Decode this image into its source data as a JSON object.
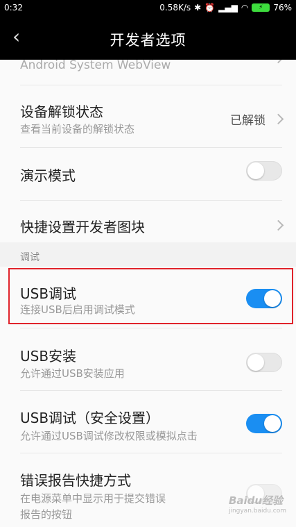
{
  "status": {
    "time": "0:32",
    "net_speed": "0.58K/s",
    "battery": "76%"
  },
  "header": {
    "title": "开发者选项"
  },
  "items": {
    "webview": {
      "title": "Android System WebView"
    },
    "unlock": {
      "title": "设备解锁状态",
      "subtitle": "查看当前设备的解锁状态",
      "value": "已解锁"
    },
    "demo": {
      "title": "演示模式",
      "toggle": false
    },
    "quick_tiles": {
      "title": "快捷设置开发者图块"
    },
    "section_debug": "调试",
    "usb_debug": {
      "title": "USB调试",
      "subtitle": "连接USB后启用调试模式",
      "toggle": true
    },
    "usb_install": {
      "title": "USB安装",
      "subtitle": "允许通过USB安装应用",
      "toggle": false
    },
    "usb_debug_secure": {
      "title": "USB调试（安全设置）",
      "subtitle": "允许通过USB调试修改权限或模拟点击",
      "toggle": true
    },
    "bug_report": {
      "title": "错误报告快捷方式",
      "subtitle_line1": "在电源菜单中显示用于提交错误",
      "subtitle_line2": "报告的按钮",
      "toggle": false
    }
  },
  "watermark": {
    "text": "Baidu经验",
    "sub": "jingyan.baidu.com"
  }
}
